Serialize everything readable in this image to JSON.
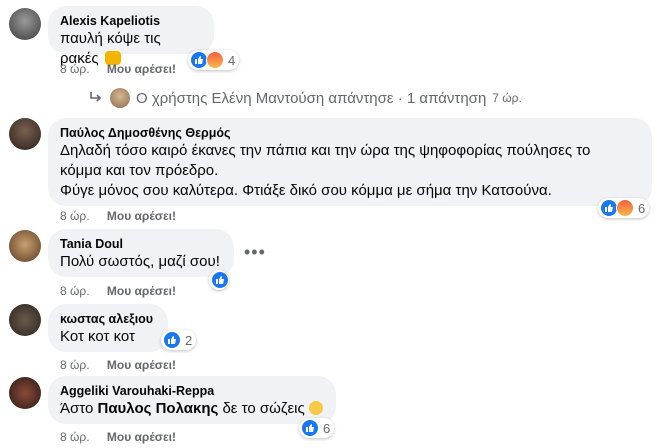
{
  "comments": [
    {
      "author": "Alexis Kapeliotis",
      "text": "παυλή κόψε τις ρακές",
      "time": "8 ώρ.",
      "like_label": "Μου αρέσει!",
      "reaction_count": "4"
    },
    {
      "author": "Παύλος Δημοσθένης Θερμός",
      "text_line1": "Δηλαδή τόσο καιρό έκανες την πάπια και την ώρα της ψηφοφορίας πούλησες το",
      "text_line2": "κόμμα και τον πρόεδρο.",
      "text_line3": "Φύγε μόνος σου καλύτερα. Φτιάξε δικό σου κόμμα με σήμα την Κατσούνα.",
      "time": "8 ώρ.",
      "like_label": "Μου αρέσει!",
      "reaction_count": "6"
    },
    {
      "author": "Tania Doul",
      "text": "Πολύ σωστός, μαζί σου!",
      "time": "8 ώρ.",
      "like_label": "Μου αρέσει!"
    },
    {
      "author": "κωστας αλεξιου",
      "text": "Κοτ κοτ κοτ",
      "time": "8 ώρ.",
      "like_label": "Μου αρέσει!",
      "reaction_count": "2"
    },
    {
      "author": "Aggeliki Varouhaki-Reppa",
      "text_prefix": "Άστο ",
      "text_mention": "Παυλος Πολακης",
      "text_suffix": " δε το σώζεις",
      "time": "8 ώρ.",
      "like_label": "Μου αρέσει!",
      "reaction_count": "6"
    }
  ],
  "reply": {
    "text": "Ο χρήστης Ελένη Μαντούση απάντησε · 1 απάντηση",
    "time": "7 ώρ."
  },
  "colors": {
    "bubble": "#f0f2f5",
    "meta": "#65676b",
    "like_blue": "#1877f2"
  }
}
